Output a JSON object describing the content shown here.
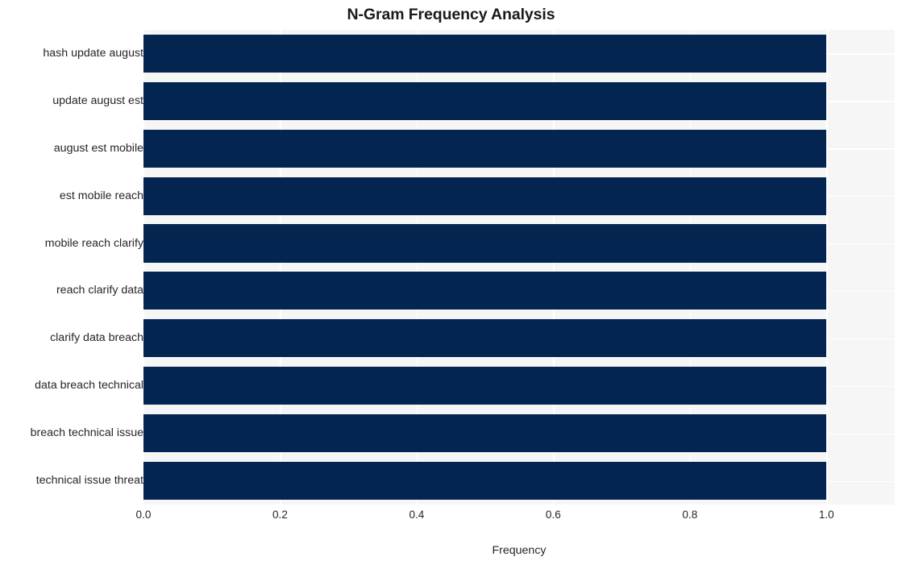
{
  "chart_data": {
    "type": "bar",
    "orientation": "horizontal",
    "title": "N-Gram Frequency Analysis",
    "xlabel": "Frequency",
    "ylabel": "",
    "categories": [
      "hash update august",
      "update august est",
      "august est mobile",
      "est mobile reach",
      "mobile reach clarify",
      "reach clarify data",
      "clarify data breach",
      "data breach technical",
      "breach technical issue",
      "technical issue threat"
    ],
    "values": [
      1.0,
      1.0,
      1.0,
      1.0,
      1.0,
      1.0,
      1.0,
      1.0,
      1.0,
      1.0
    ],
    "xlim": [
      0.0,
      1.1
    ],
    "xticks": [
      0.0,
      0.2,
      0.4,
      0.6,
      0.8,
      1.0
    ],
    "xtick_labels": [
      "0.0",
      "0.2",
      "0.4",
      "0.6",
      "0.8",
      "1.0"
    ],
    "grid": true,
    "legend": null,
    "bar_color": "#03254f",
    "plot_background": "#f6f6f6",
    "figure_background": "#ffffff",
    "grid_color": "#ffffff",
    "text_color": "#262626",
    "title_color": "#1a1a1a"
  }
}
